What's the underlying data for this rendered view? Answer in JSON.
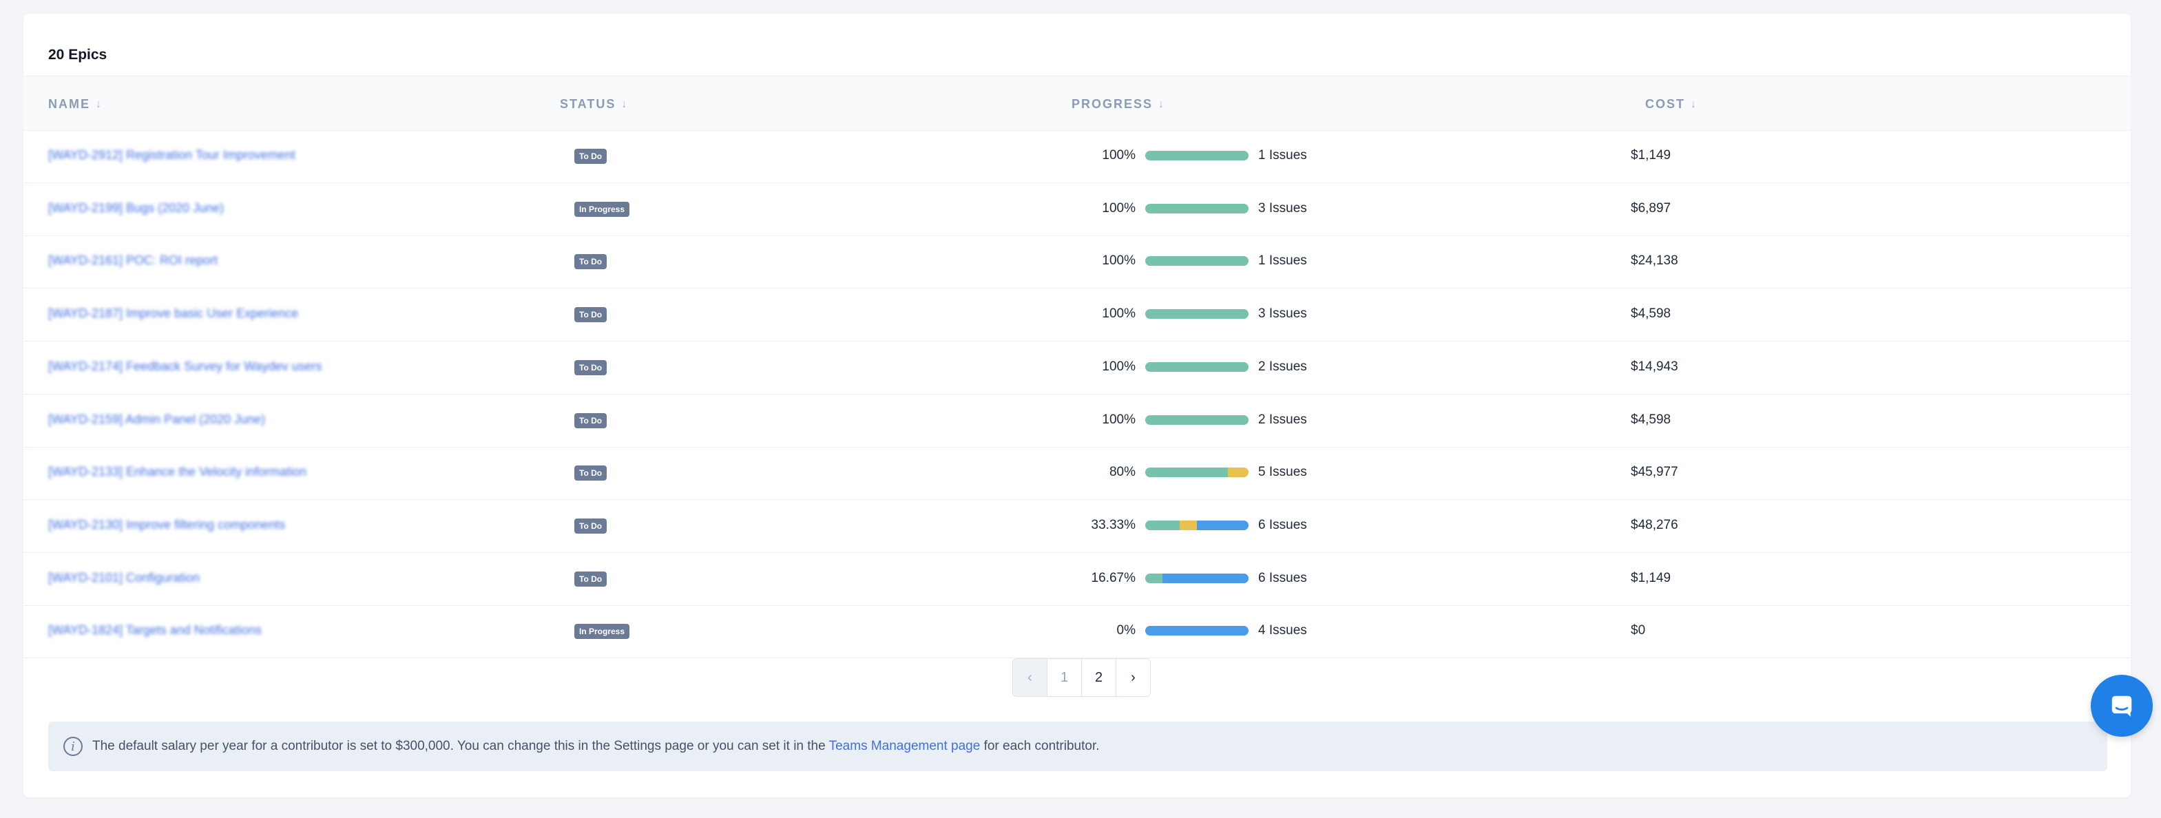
{
  "header": {
    "title": "20 Epics"
  },
  "columns": {
    "name": "NAME",
    "status": "STATUS",
    "progress": "PROGRESS",
    "cost": "COST",
    "sort_arrow": "↓"
  },
  "rows": [
    {
      "name": "[WAYD-2912] Registration Tour Improvement",
      "status": "To Do",
      "percent": "100%",
      "done": 100,
      "in_progress": 0,
      "todo": 0,
      "issues": "1 Issues",
      "cost": "$1,149"
    },
    {
      "name": "[WAYD-2199] Bugs (2020 June)",
      "status": "In Progress",
      "percent": "100%",
      "done": 100,
      "in_progress": 0,
      "todo": 0,
      "issues": "3 Issues",
      "cost": "$6,897"
    },
    {
      "name": "[WAYD-2161] POC: ROI report",
      "status": "To Do",
      "percent": "100%",
      "done": 100,
      "in_progress": 0,
      "todo": 0,
      "issues": "1 Issues",
      "cost": "$24,138"
    },
    {
      "name": "[WAYD-2187] Improve basic User Experience",
      "status": "To Do",
      "percent": "100%",
      "done": 100,
      "in_progress": 0,
      "todo": 0,
      "issues": "3 Issues",
      "cost": "$4,598"
    },
    {
      "name": "[WAYD-2174] Feedback Survey for Waydev users",
      "status": "To Do",
      "percent": "100%",
      "done": 100,
      "in_progress": 0,
      "todo": 0,
      "issues": "2 Issues",
      "cost": "$14,943"
    },
    {
      "name": "[WAYD-2159] Admin Panel (2020 June)",
      "status": "To Do",
      "percent": "100%",
      "done": 100,
      "in_progress": 0,
      "todo": 0,
      "issues": "2 Issues",
      "cost": "$4,598"
    },
    {
      "name": "[WAYD-2133] Enhance the Velocity information",
      "status": "To Do",
      "percent": "80%",
      "done": 80,
      "in_progress": 20,
      "todo": 0,
      "issues": "5 Issues",
      "cost": "$45,977"
    },
    {
      "name": "[WAYD-2130] Improve filtering components",
      "status": "To Do",
      "percent": "33.33%",
      "done": 33.33,
      "in_progress": 16.67,
      "todo": 50,
      "issues": "6 Issues",
      "cost": "$48,276"
    },
    {
      "name": "[WAYD-2101] Configuration",
      "status": "To Do",
      "percent": "16.67%",
      "done": 16.67,
      "in_progress": 0,
      "todo": 83.33,
      "issues": "6 Issues",
      "cost": "$1,149"
    },
    {
      "name": "[WAYD-1824] Targets and Notifications",
      "status": "In Progress",
      "percent": "0%",
      "done": 0,
      "in_progress": 0,
      "todo": 100,
      "issues": "4 Issues",
      "cost": "$0"
    }
  ],
  "pagination": {
    "prev": "‹",
    "pages": [
      "1",
      "2"
    ],
    "next": "›"
  },
  "info": {
    "text_before": "The default salary per year for a contributor is set to $300,000. You can change this in the Settings page or you can set it in the ",
    "link": "Teams Management page",
    "text_after": " for each contributor."
  },
  "chat": {
    "icon": "chat-icon"
  }
}
